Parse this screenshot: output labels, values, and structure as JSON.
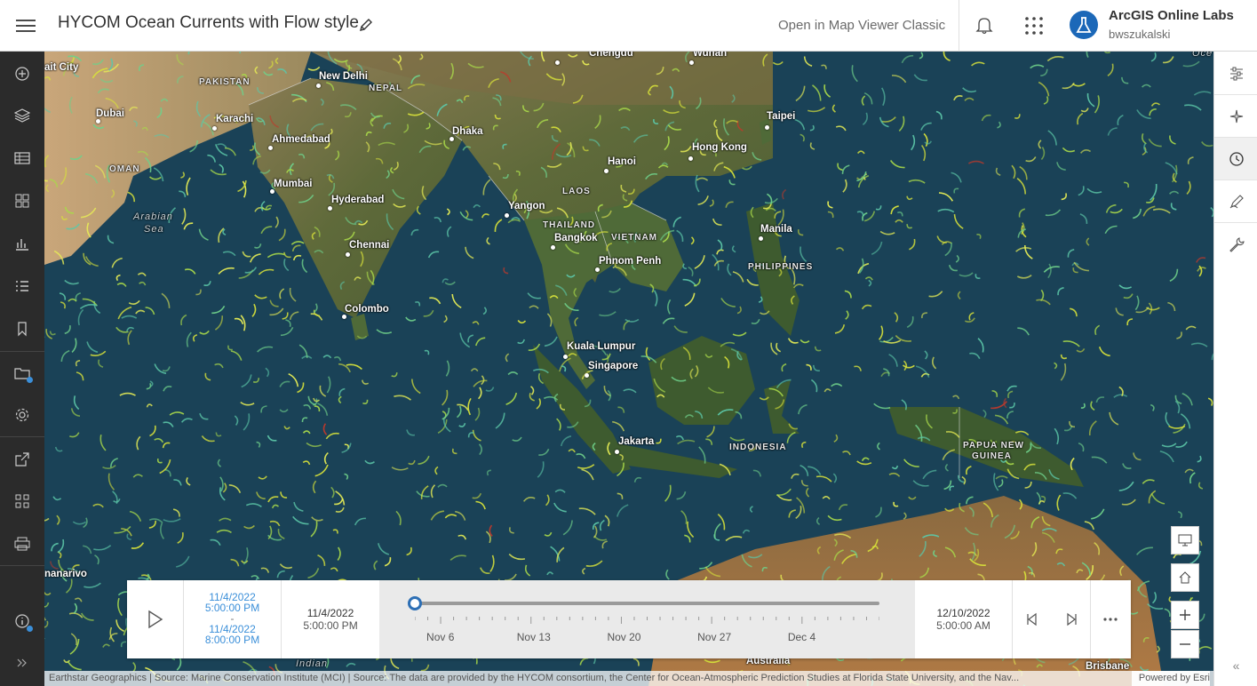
{
  "header": {
    "title": "HYCOM Ocean Currents with Flow style",
    "open_classic": "Open in Map Viewer Classic",
    "org_name": "ArcGIS Online Labs",
    "user_name": "bwszukalski"
  },
  "left_toolbar": [
    "add-icon",
    "layers-icon",
    "table-icon",
    "basemap-icon",
    "chart-icon",
    "legend-icon",
    "bookmark-icon",
    "folder-icon",
    "settings-icon",
    "share-icon",
    "apps-icon",
    "print-icon",
    "info-icon",
    "expand-icon"
  ],
  "right_toolbar": [
    "properties-icon",
    "effects-icon",
    "time-icon",
    "sketch-icon",
    "tools-icon"
  ],
  "map_labels": {
    "cities": {
      "dubai": "Dubai",
      "karachi": "Karachi",
      "new_delhi": "New Delhi",
      "ahmedabad": "Ahmedabad",
      "mumbai": "Mumbai",
      "hyderabad": "Hyderabad",
      "chennai": "Chennai",
      "colombo": "Colombo",
      "dhaka": "Dhaka",
      "yangon": "Yangon",
      "bangkok": "Bangkok",
      "phnom_penh": "Phnom Penh",
      "hanoi": "Hanoi",
      "hong_kong": "Hong Kong",
      "taipei": "Taipei",
      "manila": "Manila",
      "kuala_lumpur": "Kuala Lumpur",
      "singapore": "Singapore",
      "jakarta": "Jakarta",
      "chengdu": "Chengdu",
      "wuhan": "Wuhan",
      "brisbane": "Brisbane",
      "antananarivo": "nanarivo",
      "kuwait_city": "ait City"
    },
    "countries": {
      "pakistan": "PAKISTAN",
      "nepal": "NEPAL",
      "oman": "OMAN",
      "laos": "LAOS",
      "thailand": "THAILAND",
      "vietnam": "VIETNAM",
      "philippines": "PHILIPPINES",
      "indonesia": "INDONESIA",
      "papua_1": "PAPUA NEW",
      "papua_2": "GUINEA",
      "australia": "Australia"
    },
    "seas": {
      "arabian_1": "Arabian",
      "arabian_2": "Sea",
      "indian": "Indian",
      "ocean_edge": "Oce"
    }
  },
  "time_slider": {
    "range_start_date": "11/4/2022",
    "range_start_time": "5:00:00 PM",
    "range_sep": "-",
    "range_end_date": "11/4/2022",
    "range_end_time": "8:00:00 PM",
    "start_date": "11/4/2022",
    "start_time": "5:00:00 PM",
    "end_date": "12/10/2022",
    "end_time": "5:00:00 AM",
    "ticks": [
      "Nov 6",
      "Nov 13",
      "Nov 20",
      "Nov 27",
      "Dec 4"
    ],
    "thumb_position_percent": 0
  },
  "attribution": "Earthstar Geographics | Source: Marine Conservation Institute (MCI) | Source: The data are provided by the HYCOM consortium, the Center for Ocean-Atmospheric Prediction Studies at Florida State University, and the Nav...",
  "powered_by": "Powered by Esri",
  "colors": {
    "accent": "#1c68b8",
    "toolbar_dark": "#2b2b2b",
    "ocean": "#17394d",
    "flow_yellow": "#d8e23a",
    "flow_green": "#6fd08a",
    "flow_red": "#c0392b"
  }
}
